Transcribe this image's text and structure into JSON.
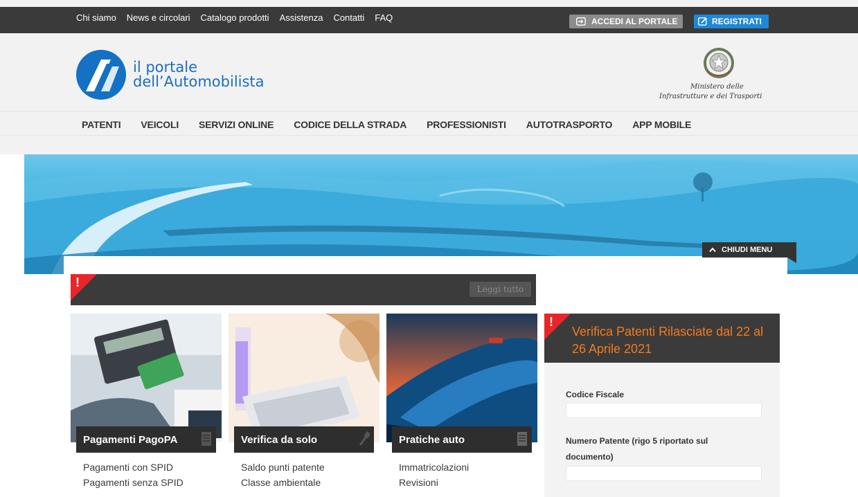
{
  "topbar": {
    "links": [
      "Chi siamo",
      "News e circolari",
      "Catalogo prodotti",
      "Assistenza",
      "Contatti",
      "FAQ"
    ],
    "accedi_label": "ACCEDI AL PORTALE",
    "registrati_label": "REGISTRATI"
  },
  "header": {
    "logo_line1": "il portale",
    "logo_line2": "dell’Automobilista",
    "ministero_line1": "Ministero delle",
    "ministero_line2": "Infrastrutture e dei Trasporti"
  },
  "nav": {
    "items": [
      "PATENTI",
      "VEICOLI",
      "SERVIZI ONLINE",
      "CODICE DELLA STRADA",
      "PROFESSIONISTI",
      "AUTOTRASPORTO",
      "APP MOBILE"
    ]
  },
  "banner": {
    "chiudi_label": "CHIUDI MENU"
  },
  "alert": {
    "mark": "!",
    "leggi_label": "Leggi tutto"
  },
  "cards": [
    {
      "title": "Pagamenti PagoPA",
      "links": [
        "Pagamenti con SPID",
        "Pagamenti senza SPID"
      ]
    },
    {
      "title": "Verifica da solo",
      "links": [
        "Saldo punti patente",
        "Classe ambientale"
      ]
    },
    {
      "title": "Pratiche auto",
      "links": [
        "Immatricolazioni",
        "Revisioni"
      ]
    }
  ],
  "verifica": {
    "mark": "!",
    "title": "Verifica Patenti Rilasciate dal 22 al 26 Aprile 2021",
    "codice_label": "Codice Fiscale",
    "codice_value": "",
    "patente_label_line1": "Numero Patente (rigo 5 riportato sul",
    "patente_label_line2": "documento)",
    "patente_value": ""
  },
  "colors": {
    "topbar": "#3a3a3a",
    "brand_blue": "#1471c4",
    "registrati": "#1e88d8",
    "alert_red": "#e8262a",
    "verifica_orange": "#f47b20"
  }
}
